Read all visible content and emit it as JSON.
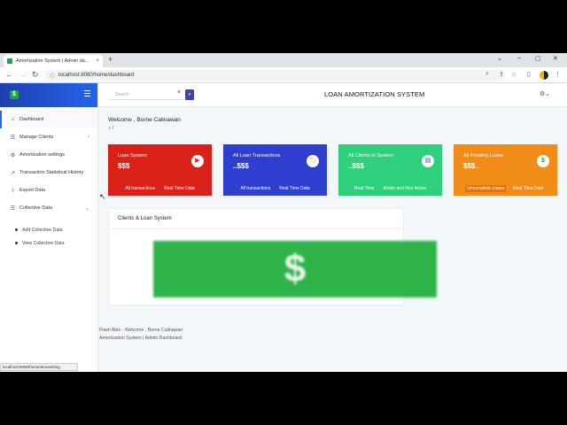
{
  "browser": {
    "tab_title": "Amortization System | Admin da...",
    "tab_close": "×",
    "new_tab": "+",
    "url": "localhost:8080/home/dashboard",
    "minimize": "⌄",
    "min": "–",
    "restore": "▢",
    "close": "✕"
  },
  "sidebar": {
    "logo": "$",
    "items": [
      {
        "label": "Dashboard",
        "icon": "⌂"
      },
      {
        "label": "Manage Clients",
        "icon": "☰",
        "chevron": "›"
      },
      {
        "label": "Amortization settings",
        "icon": "⚙"
      },
      {
        "label": "Transaction Statistical History",
        "icon": "↗"
      },
      {
        "label": "Export Data",
        "icon": "⇩"
      },
      {
        "label": "Collective Data",
        "icon": "☰",
        "chevron": "⌄"
      }
    ],
    "sub_items": [
      "Add Collective Data",
      "View Collective Data"
    ]
  },
  "header": {
    "search_placeholder": "Search",
    "search_clear": "×",
    "search_icon": "⌕",
    "title": "LOAN AMORTIZATION SYSTEM",
    "settings": "⚙⌄"
  },
  "main": {
    "welcome": "Welcome , Borne Calinawan",
    "breadcrumb": "⌂ /",
    "cards": [
      {
        "title": "Loan System",
        "value": "$$$",
        "icon": "▶",
        "foot": [
          "All transactions",
          "Real Time Data"
        ],
        "color": "#d9211a"
      },
      {
        "title": "All Loan Transactions",
        "value": "..$$$",
        "icon": "🏷",
        "foot": [
          "All transactions",
          "Real Time Data"
        ],
        "color": "#2e3fd0"
      },
      {
        "title": "All Clients in System",
        "value": "..$$$",
        "icon": "▤",
        "foot": [
          "Real Time",
          "Active and Non Active"
        ],
        "color": "#2fcf7b"
      },
      {
        "title": "All Pending Loans",
        "value": "$$$..",
        "icon": "$",
        "foot": [
          "Uncomplete Loans",
          "Real Time Data"
        ],
        "color": "#f28c18"
      }
    ],
    "panel_title": "Clients & Loan System",
    "banner_symbol": "$"
  },
  "footer": {
    "line1": "Flash Able - Welcome , Borne Calinawan",
    "line2": "Amortization System | Admin Dashboard"
  },
  "statusbar": "localhost:8080/home/amosetting"
}
